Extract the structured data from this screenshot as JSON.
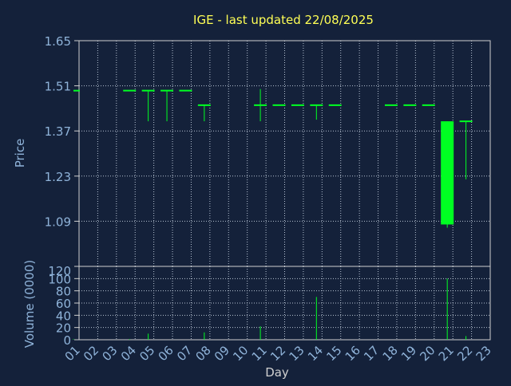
{
  "title": "IGE - last updated 22/08/2025",
  "colors": {
    "background": "#14213a",
    "title": "#ffff55",
    "axis_text": "#8fb3d9",
    "frame": "#d0d0d0",
    "grid": "#b8c4d4",
    "candle": "#00ff22"
  },
  "chart_data": [
    {
      "type": "candlestick",
      "panel": "price",
      "ylabel": "Price",
      "ylim": [
        0.95,
        1.65
      ],
      "yticks": [
        "1.65",
        "1.51",
        "1.37",
        "1.23",
        "1.09"
      ],
      "grid": true,
      "candles": [
        {
          "day": "01",
          "open": 1.495,
          "high": 1.495,
          "low": 1.495,
          "close": 1.495
        },
        {
          "day": "04",
          "open": 1.495,
          "high": 1.495,
          "low": 1.495,
          "close": 1.495
        },
        {
          "day": "05",
          "open": 1.495,
          "high": 1.495,
          "low": 1.4,
          "close": 1.495
        },
        {
          "day": "06",
          "open": 1.495,
          "high": 1.495,
          "low": 1.4,
          "close": 1.495
        },
        {
          "day": "07",
          "open": 1.495,
          "high": 1.495,
          "low": 1.495,
          "close": 1.495
        },
        {
          "day": "08",
          "open": 1.45,
          "high": 1.45,
          "low": 1.4,
          "close": 1.45
        },
        {
          "day": "11",
          "open": 1.45,
          "high": 1.5,
          "low": 1.4,
          "close": 1.45
        },
        {
          "day": "12",
          "open": 1.45,
          "high": 1.45,
          "low": 1.45,
          "close": 1.45
        },
        {
          "day": "13",
          "open": 1.45,
          "high": 1.45,
          "low": 1.45,
          "close": 1.45
        },
        {
          "day": "14",
          "open": 1.45,
          "high": 1.45,
          "low": 1.405,
          "close": 1.45
        },
        {
          "day": "15",
          "open": 1.45,
          "high": 1.45,
          "low": 1.45,
          "close": 1.45
        },
        {
          "day": "18",
          "open": 1.45,
          "high": 1.45,
          "low": 1.45,
          "close": 1.45
        },
        {
          "day": "19",
          "open": 1.45,
          "high": 1.45,
          "low": 1.45,
          "close": 1.45
        },
        {
          "day": "20",
          "open": 1.45,
          "high": 1.45,
          "low": 1.45,
          "close": 1.45
        },
        {
          "day": "21",
          "open": 1.4,
          "high": 1.4,
          "low": 1.07,
          "close": 1.08
        },
        {
          "day": "22",
          "open": 1.4,
          "high": 1.4,
          "low": 1.22,
          "close": 1.4
        }
      ]
    },
    {
      "type": "bar",
      "panel": "volume",
      "ylabel": "Volume (0000)",
      "ylim": [
        0,
        120
      ],
      "yticks": [
        "120",
        "100",
        "80",
        "60",
        "40",
        "20",
        "0"
      ],
      "grid": true,
      "xlabel": "Day",
      "categories": [
        "01",
        "02",
        "03",
        "04",
        "05",
        "06",
        "07",
        "08",
        "09",
        "10",
        "11",
        "12",
        "13",
        "14",
        "15",
        "16",
        "17",
        "18",
        "19",
        "20",
        "21",
        "22",
        "23"
      ],
      "values": [
        1,
        0,
        0,
        1,
        10,
        0,
        0,
        12,
        0,
        0,
        22,
        0,
        0,
        70,
        0,
        0,
        0,
        0,
        0,
        0,
        100,
        6,
        0
      ]
    }
  ]
}
